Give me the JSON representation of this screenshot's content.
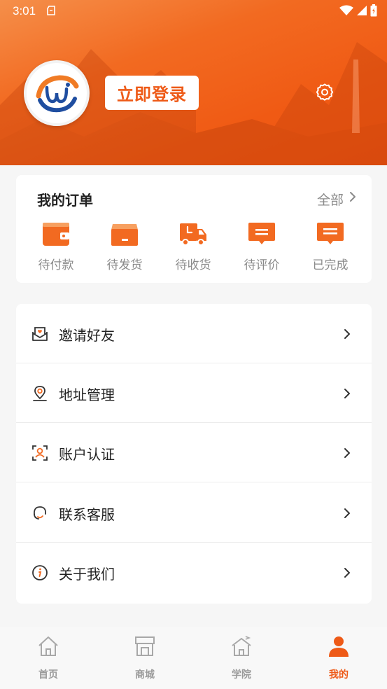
{
  "status_bar": {
    "time": "3:01"
  },
  "header": {
    "login_label": "立即登录",
    "icons": {
      "avatar": "brand-logo",
      "settings": "gear-icon"
    }
  },
  "orders": {
    "title": "我的订单",
    "all_label": "全部",
    "items": [
      {
        "label": "待付款",
        "icon": "wallet-icon"
      },
      {
        "label": "待发货",
        "icon": "box-icon"
      },
      {
        "label": "待收货",
        "icon": "truck-icon"
      },
      {
        "label": "待评价",
        "icon": "comment-icon"
      },
      {
        "label": "已完成",
        "icon": "message-done-icon"
      }
    ]
  },
  "menu": {
    "items": [
      {
        "label": "邀请好友",
        "icon": "invite-mail-icon"
      },
      {
        "label": "地址管理",
        "icon": "location-pin-icon"
      },
      {
        "label": "账户认证",
        "icon": "user-verify-icon"
      },
      {
        "label": "联系客服",
        "icon": "headset-icon"
      },
      {
        "label": "关于我们",
        "icon": "info-icon"
      }
    ]
  },
  "tabbar": {
    "items": [
      {
        "label": "首页",
        "icon": "home-icon",
        "active": false
      },
      {
        "label": "商城",
        "icon": "store-icon",
        "active": false
      },
      {
        "label": "学院",
        "icon": "academy-icon",
        "active": false
      },
      {
        "label": "我的",
        "icon": "person-icon",
        "active": true
      }
    ]
  },
  "colors": {
    "accent": "#ee5a17",
    "muted_text": "#8a8a8a",
    "background": "#f6f6f6"
  }
}
